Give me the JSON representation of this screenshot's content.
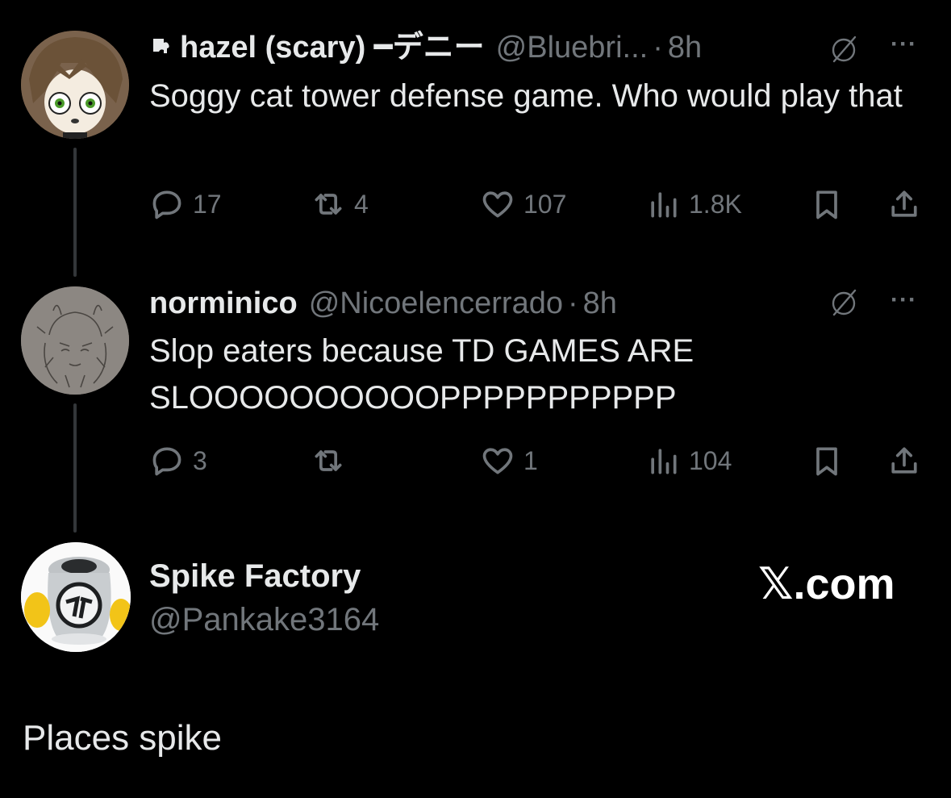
{
  "tweets": [
    {
      "name": "hazel (scary) ━デニー",
      "name_prefix_icon": "puzzle-piece-icon",
      "handle": "@Bluebri...",
      "time": "8h",
      "text": "Soggy cat tower defense game. Who would play that",
      "replies": "17",
      "reposts": "4",
      "likes": "107",
      "views": "1.8K"
    },
    {
      "name": "norminico",
      "handle": "@Nicoelencerrado",
      "time": "8h",
      "text": "Slop eaters because TD GAMES ARE SLOOOOOOOOOOPPPPPPPPPPP",
      "replies": "3",
      "reposts": "",
      "likes": "1",
      "views": "104"
    }
  ],
  "quote": {
    "name": "Spike Factory",
    "handle": "@Pankake3164",
    "site": "𝕏.com",
    "text": "Places spike"
  },
  "icons": {
    "reply": "reply-icon",
    "repost": "repost-icon",
    "like": "like-icon",
    "views": "views-icon",
    "bookmark": "bookmark-icon",
    "share": "share-icon",
    "grok": "grok-icon",
    "more": "more-icon"
  },
  "colors": {
    "background": "#000000",
    "text": "#e7e9ea",
    "muted": "#71767b",
    "thread_line": "#333639"
  }
}
